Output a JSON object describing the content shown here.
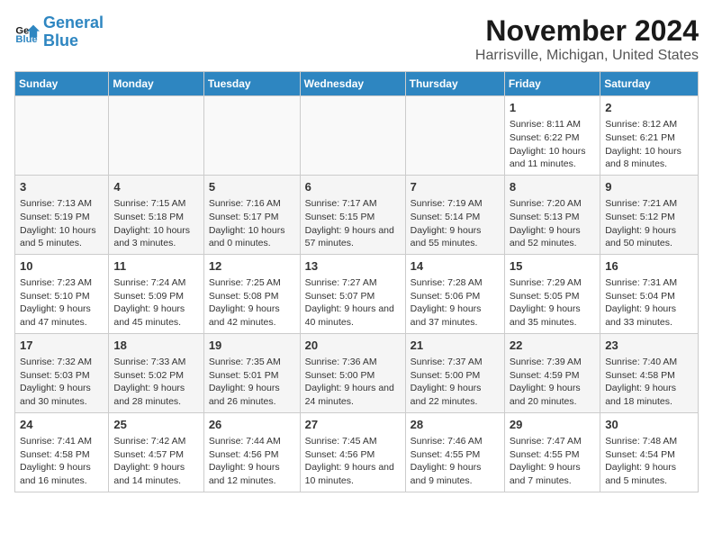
{
  "logo": {
    "line1": "General",
    "line2": "Blue"
  },
  "title": "November 2024",
  "subtitle": "Harrisville, Michigan, United States",
  "days_of_week": [
    "Sunday",
    "Monday",
    "Tuesday",
    "Wednesday",
    "Thursday",
    "Friday",
    "Saturday"
  ],
  "weeks": [
    [
      {
        "day": "",
        "info": ""
      },
      {
        "day": "",
        "info": ""
      },
      {
        "day": "",
        "info": ""
      },
      {
        "day": "",
        "info": ""
      },
      {
        "day": "",
        "info": ""
      },
      {
        "day": "1",
        "info": "Sunrise: 8:11 AM\nSunset: 6:22 PM\nDaylight: 10 hours and 11 minutes."
      },
      {
        "day": "2",
        "info": "Sunrise: 8:12 AM\nSunset: 6:21 PM\nDaylight: 10 hours and 8 minutes."
      }
    ],
    [
      {
        "day": "3",
        "info": "Sunrise: 7:13 AM\nSunset: 5:19 PM\nDaylight: 10 hours and 5 minutes."
      },
      {
        "day": "4",
        "info": "Sunrise: 7:15 AM\nSunset: 5:18 PM\nDaylight: 10 hours and 3 minutes."
      },
      {
        "day": "5",
        "info": "Sunrise: 7:16 AM\nSunset: 5:17 PM\nDaylight: 10 hours and 0 minutes."
      },
      {
        "day": "6",
        "info": "Sunrise: 7:17 AM\nSunset: 5:15 PM\nDaylight: 9 hours and 57 minutes."
      },
      {
        "day": "7",
        "info": "Sunrise: 7:19 AM\nSunset: 5:14 PM\nDaylight: 9 hours and 55 minutes."
      },
      {
        "day": "8",
        "info": "Sunrise: 7:20 AM\nSunset: 5:13 PM\nDaylight: 9 hours and 52 minutes."
      },
      {
        "day": "9",
        "info": "Sunrise: 7:21 AM\nSunset: 5:12 PM\nDaylight: 9 hours and 50 minutes."
      }
    ],
    [
      {
        "day": "10",
        "info": "Sunrise: 7:23 AM\nSunset: 5:10 PM\nDaylight: 9 hours and 47 minutes."
      },
      {
        "day": "11",
        "info": "Sunrise: 7:24 AM\nSunset: 5:09 PM\nDaylight: 9 hours and 45 minutes."
      },
      {
        "day": "12",
        "info": "Sunrise: 7:25 AM\nSunset: 5:08 PM\nDaylight: 9 hours and 42 minutes."
      },
      {
        "day": "13",
        "info": "Sunrise: 7:27 AM\nSunset: 5:07 PM\nDaylight: 9 hours and 40 minutes."
      },
      {
        "day": "14",
        "info": "Sunrise: 7:28 AM\nSunset: 5:06 PM\nDaylight: 9 hours and 37 minutes."
      },
      {
        "day": "15",
        "info": "Sunrise: 7:29 AM\nSunset: 5:05 PM\nDaylight: 9 hours and 35 minutes."
      },
      {
        "day": "16",
        "info": "Sunrise: 7:31 AM\nSunset: 5:04 PM\nDaylight: 9 hours and 33 minutes."
      }
    ],
    [
      {
        "day": "17",
        "info": "Sunrise: 7:32 AM\nSunset: 5:03 PM\nDaylight: 9 hours and 30 minutes."
      },
      {
        "day": "18",
        "info": "Sunrise: 7:33 AM\nSunset: 5:02 PM\nDaylight: 9 hours and 28 minutes."
      },
      {
        "day": "19",
        "info": "Sunrise: 7:35 AM\nSunset: 5:01 PM\nDaylight: 9 hours and 26 minutes."
      },
      {
        "day": "20",
        "info": "Sunrise: 7:36 AM\nSunset: 5:00 PM\nDaylight: 9 hours and 24 minutes."
      },
      {
        "day": "21",
        "info": "Sunrise: 7:37 AM\nSunset: 5:00 PM\nDaylight: 9 hours and 22 minutes."
      },
      {
        "day": "22",
        "info": "Sunrise: 7:39 AM\nSunset: 4:59 PM\nDaylight: 9 hours and 20 minutes."
      },
      {
        "day": "23",
        "info": "Sunrise: 7:40 AM\nSunset: 4:58 PM\nDaylight: 9 hours and 18 minutes."
      }
    ],
    [
      {
        "day": "24",
        "info": "Sunrise: 7:41 AM\nSunset: 4:58 PM\nDaylight: 9 hours and 16 minutes."
      },
      {
        "day": "25",
        "info": "Sunrise: 7:42 AM\nSunset: 4:57 PM\nDaylight: 9 hours and 14 minutes."
      },
      {
        "day": "26",
        "info": "Sunrise: 7:44 AM\nSunset: 4:56 PM\nDaylight: 9 hours and 12 minutes."
      },
      {
        "day": "27",
        "info": "Sunrise: 7:45 AM\nSunset: 4:56 PM\nDaylight: 9 hours and 10 minutes."
      },
      {
        "day": "28",
        "info": "Sunrise: 7:46 AM\nSunset: 4:55 PM\nDaylight: 9 hours and 9 minutes."
      },
      {
        "day": "29",
        "info": "Sunrise: 7:47 AM\nSunset: 4:55 PM\nDaylight: 9 hours and 7 minutes."
      },
      {
        "day": "30",
        "info": "Sunrise: 7:48 AM\nSunset: 4:54 PM\nDaylight: 9 hours and 5 minutes."
      }
    ]
  ]
}
